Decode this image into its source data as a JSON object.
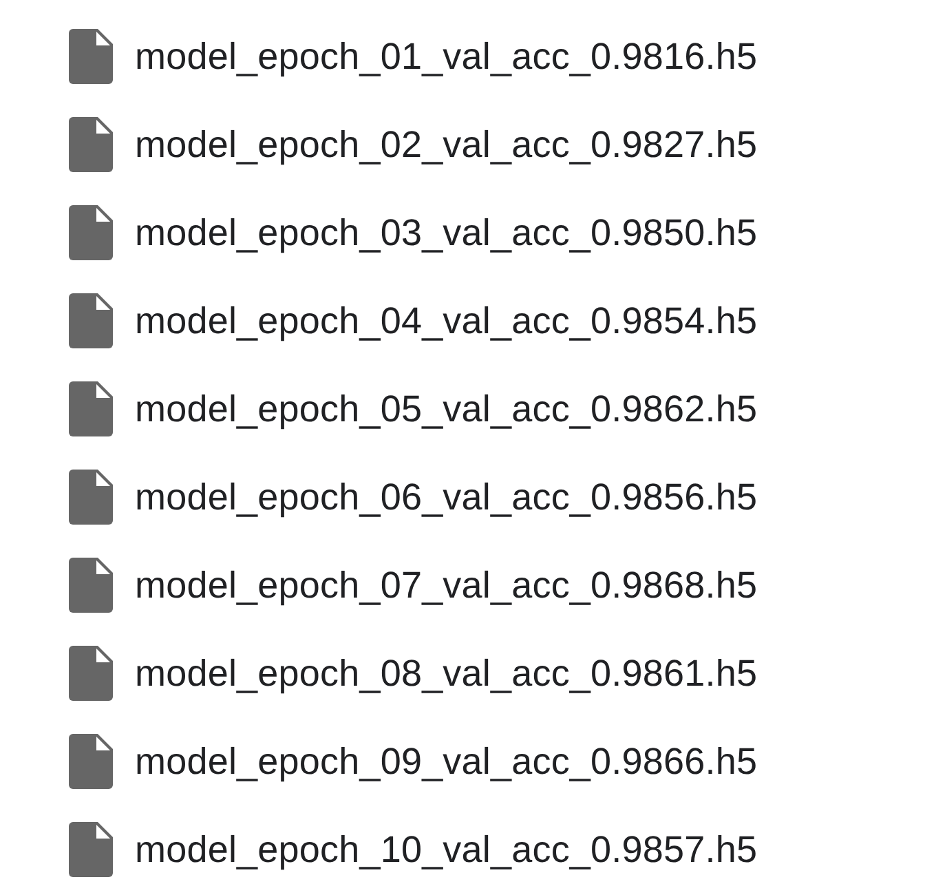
{
  "files": [
    {
      "name": "model_epoch_01_val_acc_0.9816.h5"
    },
    {
      "name": "model_epoch_02_val_acc_0.9827.h5"
    },
    {
      "name": "model_epoch_03_val_acc_0.9850.h5"
    },
    {
      "name": "model_epoch_04_val_acc_0.9854.h5"
    },
    {
      "name": "model_epoch_05_val_acc_0.9862.h5"
    },
    {
      "name": "model_epoch_06_val_acc_0.9856.h5"
    },
    {
      "name": "model_epoch_07_val_acc_0.9868.h5"
    },
    {
      "name": "model_epoch_08_val_acc_0.9861.h5"
    },
    {
      "name": "model_epoch_09_val_acc_0.9866.h5"
    },
    {
      "name": "model_epoch_10_val_acc_0.9857.h5"
    }
  ]
}
